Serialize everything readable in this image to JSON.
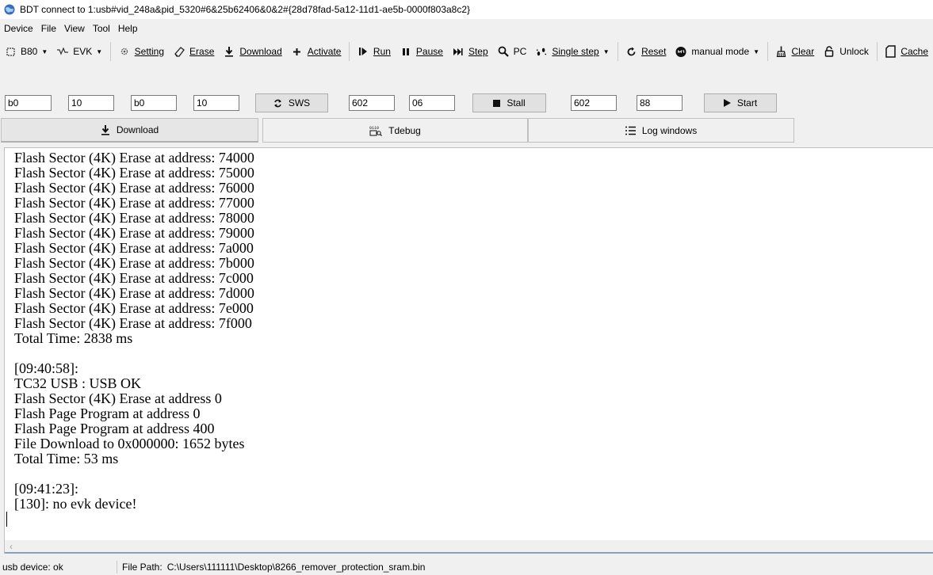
{
  "window": {
    "title": "BDT connect to 1:usb#vid_248a&pid_5320#6&25b62406&0&2#{28d78fad-5a12-11d1-ae5b-0000f803a8c2}"
  },
  "menu": [
    "Device",
    "File",
    "View",
    "Tool",
    "Help"
  ],
  "toolbar": {
    "chip": "B80",
    "evk": "EVK",
    "setting": "Setting",
    "erase": "Erase",
    "download": "Download",
    "activate": "Activate",
    "run": "Run",
    "pause": "Pause",
    "step": "Step",
    "pc": "PC",
    "single_step": "Single step",
    "reset": "Reset",
    "manual_mode": "manual mode",
    "clear": "Clear",
    "unlock": "Unlock",
    "cache": "Cache"
  },
  "params": {
    "in1": "b0",
    "in2": "10",
    "in3": "b0",
    "in4": "10",
    "sws": "SWS",
    "in5": "602",
    "in6": "06",
    "stall": "Stall",
    "in7": "602",
    "in8": "88",
    "start": "Start"
  },
  "tabs": {
    "download": "Download",
    "tdebug": "Tdebug",
    "log": "Log windows"
  },
  "log": {
    "lines": [
      "Flash Sector (4K) Erase at address: 74000",
      "Flash Sector (4K) Erase at address: 75000",
      "Flash Sector (4K) Erase at address: 76000",
      "Flash Sector (4K) Erase at address: 77000",
      "Flash Sector (4K) Erase at address: 78000",
      "Flash Sector (4K) Erase at address: 79000",
      "Flash Sector (4K) Erase at address: 7a000",
      "Flash Sector (4K) Erase at address: 7b000",
      "Flash Sector (4K) Erase at address: 7c000",
      "Flash Sector (4K) Erase at address: 7d000",
      "Flash Sector (4K) Erase at address: 7e000",
      "Flash Sector (4K) Erase at address: 7f000",
      "Total Time: 2838 ms",
      "",
      "[09:40:58]:",
      "TC32 USB : USB OK",
      "Flash Sector (4K) Erase at address 0",
      "Flash Page Program at address 0",
      "Flash Page Program at address 400",
      "File Download to 0x000000: 1652 bytes",
      "Total Time: 53 ms",
      "",
      "[09:41:23]:",
      "[130]: no evk device!"
    ]
  },
  "status": {
    "device": "usb device: ok",
    "path_label": "File Path:",
    "path": "C:\\Users\\111111\\Desktop\\8266_remover_protection_sram.bin"
  }
}
